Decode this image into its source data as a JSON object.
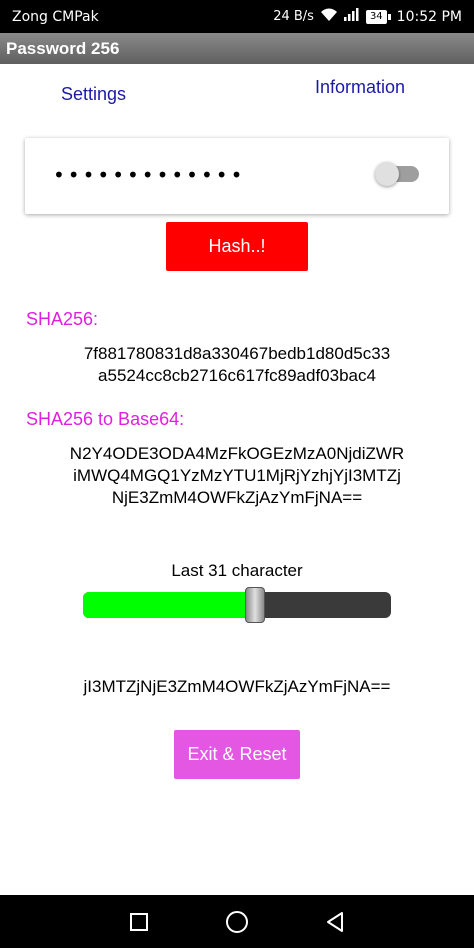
{
  "status_bar": {
    "carrier": "Zong CMPak",
    "net_speed": "24 B/s",
    "battery": "34",
    "time": "10:52 PM"
  },
  "app": {
    "title": "Password 256"
  },
  "links": {
    "settings": "Settings",
    "information": "Information"
  },
  "password": {
    "value": "•••••••••••••",
    "show_toggle_on": false
  },
  "buttons": {
    "hash": "Hash..!",
    "exit_reset": "Exit & Reset"
  },
  "sha256": {
    "label": "SHA256:",
    "line1": "7f881780831d8a330467bedb1d80d5c33",
    "line2": "a5524cc8cb2716c617fc89adf03bac4"
  },
  "base64": {
    "label": "SHA256 to Base64:",
    "line1": "N2Y4ODE3ODA4MzFkOGEzMzA0NjdiZWR",
    "line2": "iMWQ4MGQ1YzMzYTU1MjRjYzhjYjI3MTZj",
    "line3": "NjE3ZmM4OWFkZjAzYmFjNA=="
  },
  "slider": {
    "label": "Last 31 character",
    "fraction": 0.56
  },
  "result": {
    "value": "jI3MTZjNjE3ZmM4OWFkZjAzYmFjNA=="
  },
  "colors": {
    "hash_button": "#ff0000",
    "exit_button": "#e357e3",
    "label_magenta": "#e020e0",
    "link_blue": "#1a1aa6",
    "slider_fill": "#00ff00"
  },
  "icons": {
    "wifi": "wifi-icon",
    "signal": "signal-icon",
    "nav_recent": "square-icon",
    "nav_home": "circle-icon",
    "nav_back": "triangle-back-icon"
  }
}
